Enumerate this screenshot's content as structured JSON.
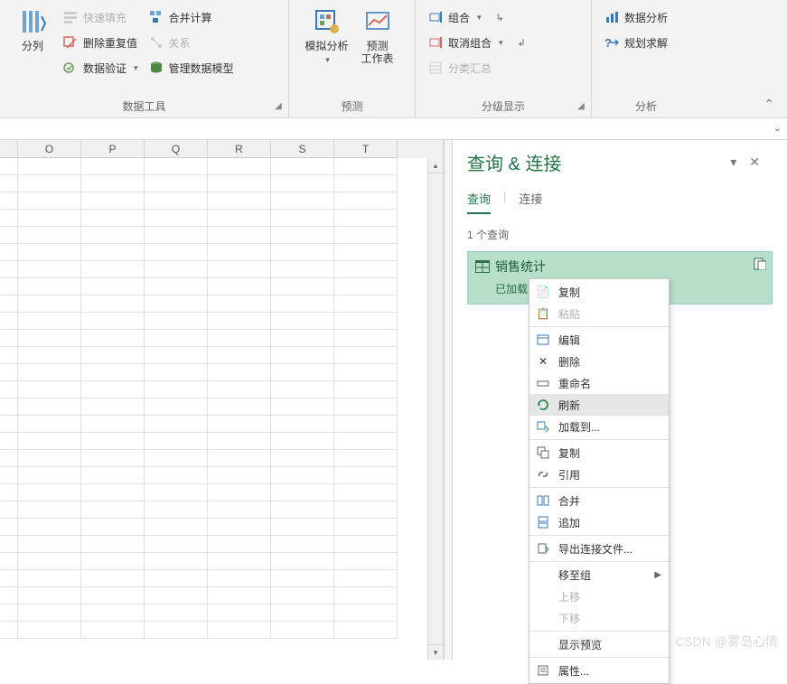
{
  "ribbon": {
    "groups": {
      "data_tools": {
        "label": "数据工具",
        "text_to_columns": "分列",
        "flash_fill": "快速填充",
        "remove_duplicates": "删除重复值",
        "data_validation": "数据验证",
        "consolidate": "合并计算",
        "relationships": "关系",
        "data_model": "管理数据模型"
      },
      "forecast": {
        "label": "预测",
        "whatif": "模拟分析",
        "forecast_sheet_l1": "预测",
        "forecast_sheet_l2": "工作表"
      },
      "outline": {
        "label": "分级显示",
        "group": "组合",
        "ungroup": "取消组合",
        "subtotal": "分类汇总"
      },
      "analysis": {
        "label": "分析",
        "data_analysis": "数据分析",
        "solver": "规划求解"
      }
    }
  },
  "grid": {
    "columns": [
      "O",
      "P",
      "Q",
      "R",
      "S",
      "T"
    ]
  },
  "pane": {
    "title": "查询 & 连接",
    "tab_query": "查询",
    "tab_connection": "连接",
    "count_label": "1 个查询",
    "query_name": "销售统计",
    "query_status_prefix": "已加载 3"
  },
  "menu": {
    "copy": "复制",
    "paste": "粘贴",
    "edit": "编辑",
    "delete": "删除",
    "rename": "重命名",
    "refresh": "刷新",
    "load_to": "加载到...",
    "duplicate": "复制",
    "reference": "引用",
    "merge": "合并",
    "append": "追加",
    "export_conn": "导出连接文件...",
    "move_to_group": "移至组",
    "move_up": "上移",
    "move_down": "下移",
    "show_preview": "显示预览",
    "properties": "属性..."
  },
  "watermark": "CSDN @雾岛心情"
}
